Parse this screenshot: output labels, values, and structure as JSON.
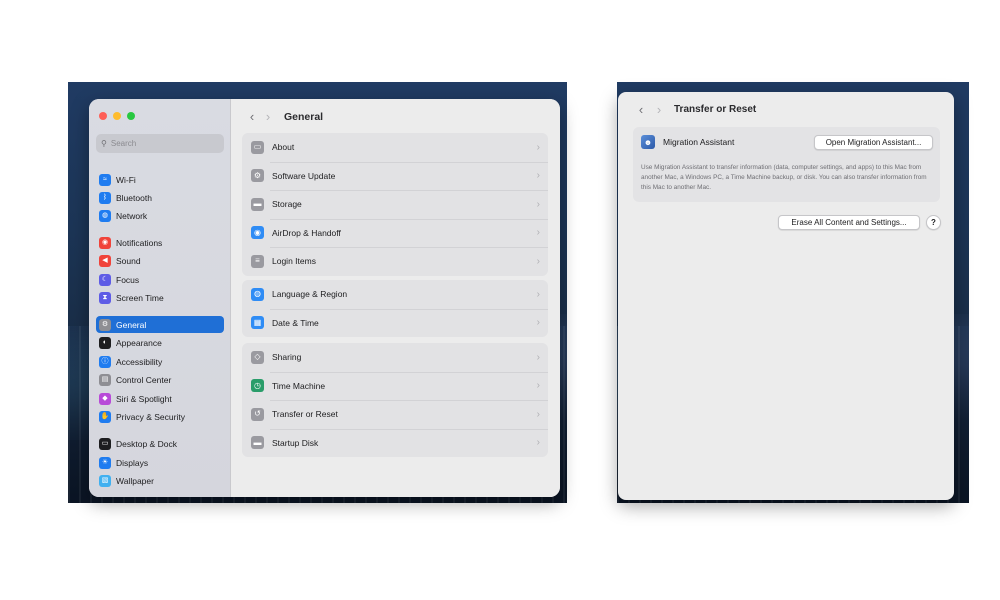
{
  "left_window": {
    "search_placeholder": "Search",
    "sidebar_items": [
      {
        "label": "Wi-Fi",
        "icon": "wifi-icon",
        "color": "#1f7cf0"
      },
      {
        "label": "Bluetooth",
        "icon": "bluetooth-icon",
        "color": "#1f7cf0"
      },
      {
        "label": "Network",
        "icon": "globe-icon",
        "color": "#1f7cf0"
      },
      {
        "label": "Notifications",
        "icon": "bell-icon",
        "color": "#f0433a"
      },
      {
        "label": "Sound",
        "icon": "speaker-icon",
        "color": "#f0433a"
      },
      {
        "label": "Focus",
        "icon": "moon-icon",
        "color": "#5e5ce6"
      },
      {
        "label": "Screen Time",
        "icon": "hourglass-icon",
        "color": "#5e5ce6"
      },
      {
        "label": "General",
        "icon": "gear-icon",
        "color": "#8e8e93",
        "selected": true
      },
      {
        "label": "Appearance",
        "icon": "appearance-icon",
        "color": "#1d1d1f"
      },
      {
        "label": "Accessibility",
        "icon": "accessibility-icon",
        "color": "#1f7cf0"
      },
      {
        "label": "Control Center",
        "icon": "control-center-icon",
        "color": "#8e8e93"
      },
      {
        "label": "Siri & Spotlight",
        "icon": "siri-icon",
        "color": "#b84ad8"
      },
      {
        "label": "Privacy & Security",
        "icon": "hand-icon",
        "color": "#1f7cf0"
      },
      {
        "label": "Desktop & Dock",
        "icon": "dock-icon",
        "color": "#1d1d1f"
      },
      {
        "label": "Displays",
        "icon": "sun-icon",
        "color": "#1f7cf0"
      },
      {
        "label": "Wallpaper",
        "icon": "wallpaper-icon",
        "color": "#40b0f0"
      }
    ],
    "header": {
      "back": "‹",
      "forward": "›",
      "title": "General"
    },
    "groups": [
      [
        {
          "label": "About",
          "icon": "laptop-icon",
          "color": "#9a9aa0",
          "glyph": "▭"
        },
        {
          "label": "Software Update",
          "icon": "gear-icon",
          "color": "#9a9aa0",
          "glyph": "⚙"
        },
        {
          "label": "Storage",
          "icon": "drive-icon",
          "color": "#9a9aa0",
          "glyph": "▬"
        },
        {
          "label": "AirDrop & Handoff",
          "icon": "airdrop-icon",
          "color": "#2f8cf5",
          "glyph": "◉"
        },
        {
          "label": "Login Items",
          "icon": "list-icon",
          "color": "#9a9aa0",
          "glyph": "≡"
        }
      ],
      [
        {
          "label": "Language & Region",
          "icon": "globe-icon",
          "color": "#2f8cf5",
          "glyph": "◍"
        },
        {
          "label": "Date & Time",
          "icon": "calendar-icon",
          "color": "#2f8cf5",
          "glyph": "▦"
        }
      ],
      [
        {
          "label": "Sharing",
          "icon": "sharing-icon",
          "color": "#9a9aa0",
          "glyph": "◇"
        },
        {
          "label": "Time Machine",
          "icon": "time-machine-icon",
          "color": "#2a9d6a",
          "glyph": "◷"
        },
        {
          "label": "Transfer or Reset",
          "icon": "reset-icon",
          "color": "#9a9aa0",
          "glyph": "↺"
        },
        {
          "label": "Startup Disk",
          "icon": "disk-icon",
          "color": "#9a9aa0",
          "glyph": "▬"
        }
      ]
    ],
    "chevron": "›"
  },
  "right_window": {
    "header": {
      "back": "‹",
      "forward": "›",
      "title": "Transfer or Reset"
    },
    "migration": {
      "label": "Migration Assistant",
      "button": "Open Migration Assistant...",
      "description": "Use Migration Assistant to transfer information (data, computer settings, and apps) to this Mac from another Mac, a Windows PC, a Time Machine backup, or disk. You can also transfer information from this Mac to another Mac."
    },
    "erase_button": "Erase All Content and Settings...",
    "help_button": "?"
  }
}
